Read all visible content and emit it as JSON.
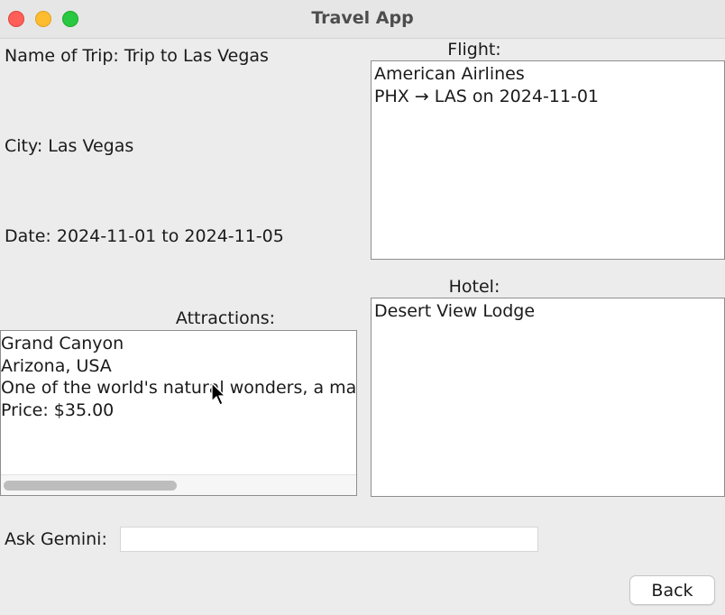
{
  "window": {
    "title": "Travel App"
  },
  "trip": {
    "name_label": "Name of Trip: Trip to Las Vegas",
    "city_label": "City: Las Vegas",
    "date_label": "Date: 2024-11-01 to 2024-11-05"
  },
  "flight": {
    "heading": "Flight:",
    "lines": [
      "American Airlines",
      "PHX → LAS on 2024-11-01"
    ]
  },
  "hotel": {
    "heading": "Hotel:",
    "lines": [
      "Desert View Lodge"
    ]
  },
  "attractions": {
    "heading": "Attractions:",
    "lines": [
      "Grand Canyon",
      "Arizona, USA",
      "One of the world's natural wonders, a ma",
      "Price: $35.00"
    ]
  },
  "gemini": {
    "label": "Ask Gemini:",
    "value": "",
    "placeholder": ""
  },
  "buttons": {
    "back": "Back"
  },
  "colors": {
    "close": "#fe5f57",
    "minimize": "#febc2e",
    "zoom": "#28c840"
  }
}
